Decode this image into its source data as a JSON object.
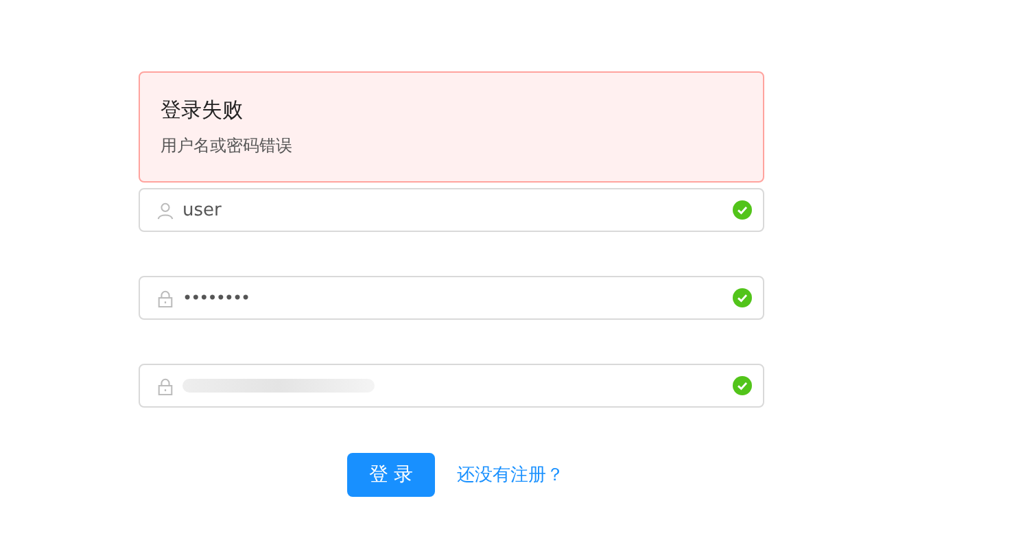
{
  "alert": {
    "title": "登录失败",
    "message": "用户名或密码错误"
  },
  "fields": [
    {
      "kind": "user",
      "value": "user",
      "valid": true
    },
    {
      "kind": "lock",
      "value": "••••••••",
      "valid": true
    },
    {
      "kind": "code",
      "obscured": true,
      "valid": true
    }
  ],
  "login_button": "登 录",
  "register_link": "还没有注册？"
}
